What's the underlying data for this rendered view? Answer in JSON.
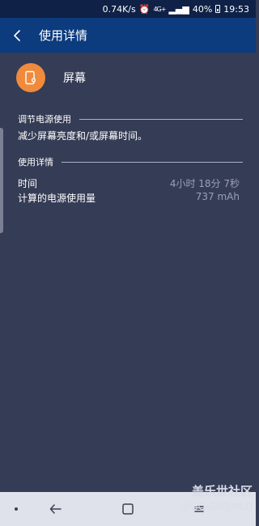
{
  "status_bar": {
    "speed": "0.74K/s",
    "network": "4G+",
    "battery": "40%",
    "time": "19:53"
  },
  "app_bar": {
    "title": "使用详情"
  },
  "app": {
    "name": "屏幕",
    "icon": "screen-brightness-icon",
    "icon_color": "#f08a3c"
  },
  "power_section": {
    "title": "调节电源使用",
    "description": "减少屏幕亮度和/或屏幕时间。"
  },
  "details_section": {
    "title": "使用详情",
    "rows": [
      {
        "label": "时间",
        "value": "4小时 18分 7秒"
      },
      {
        "label": "计算的电源使用量",
        "value": "737 mAh"
      }
    ]
  },
  "watermark": {
    "line1": "盖乐世社区",
    "line2": "@GC-G90JMLO"
  },
  "colors": {
    "status_bar": "#0f2147",
    "app_bar": "#0c3b7e",
    "background": "#353c55",
    "nav_bar": "#dfe2ea"
  }
}
